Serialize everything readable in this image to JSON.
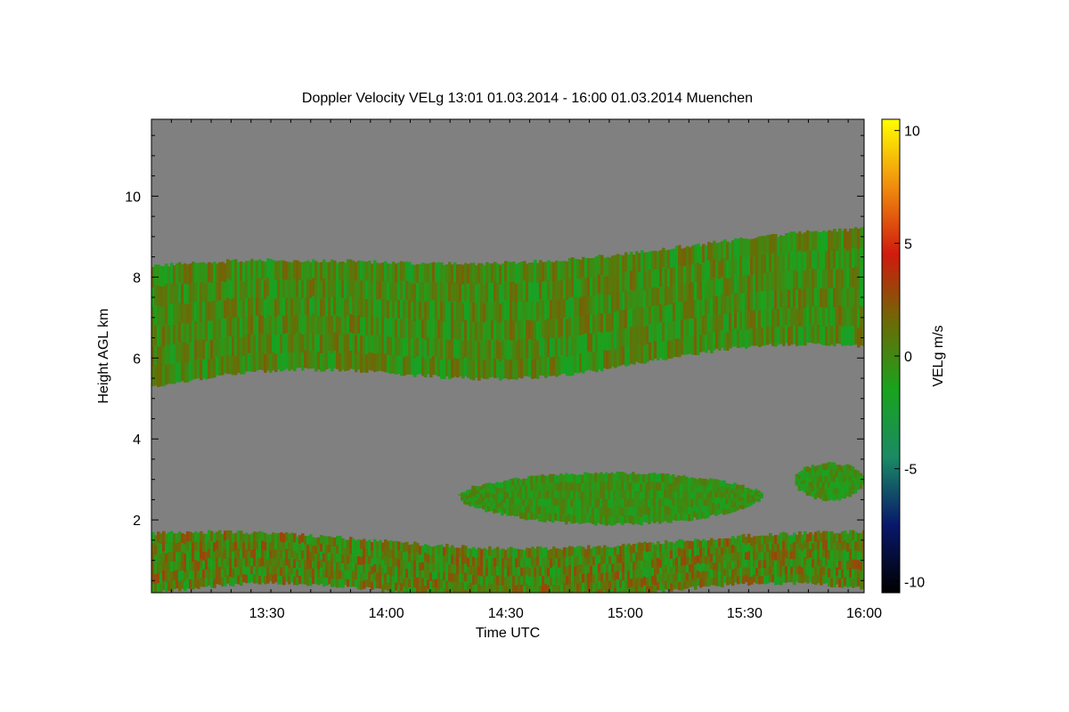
{
  "chart_data": {
    "type": "heatmap",
    "title": "Doppler Velocity VELg   13:01 01.03.2014 - 16:00 01.03.2014 Muenchen",
    "xlabel": "Time UTC",
    "ylabel": "Height AGL km",
    "xlim": [
      "13:01",
      "16:00"
    ],
    "ylim": [
      0.2,
      11.9
    ],
    "x_ticks": [
      "13:30",
      "14:00",
      "14:30",
      "15:00",
      "15:30",
      "16:00"
    ],
    "y_ticks": [
      "2",
      "4",
      "6",
      "8",
      "10"
    ],
    "colorbar": {
      "label": "VELg m/s",
      "range": [
        -10.5,
        10.5
      ],
      "ticks": [
        "-10",
        "-5",
        "0",
        "5",
        "10"
      ],
      "colors": [
        "#000000",
        "#08186b",
        "#1a8a64",
        "#19a31e",
        "#6b6b06",
        "#d01a0e",
        "#f08c0e",
        "#ffff00"
      ]
    },
    "background_color": "#808080",
    "features": [
      {
        "name": "upper cloud layer",
        "t_start": "13:01",
        "t_end": "16:00",
        "base_km": [
          5.3,
          6.2
        ],
        "top_km": [
          8.1,
          9.0
        ],
        "velocity_ms": [
          -2,
          2
        ]
      },
      {
        "name": "mid-level cloud",
        "t_start": "14:18",
        "t_end": "15:34",
        "base_km": 1.9,
        "top_km": 3.3,
        "velocity_ms": [
          -2,
          1
        ]
      },
      {
        "name": "mid-level cloud (late)",
        "t_start": "15:42",
        "t_end": "16:00",
        "base_km": 2.5,
        "top_km": 3.5,
        "velocity_ms": [
          -2,
          1
        ]
      },
      {
        "name": "boundary layer",
        "t_start": "13:01",
        "t_end": "16:00",
        "base_km": 0.2,
        "top_km": 1.5,
        "velocity_ms": [
          -2,
          3
        ]
      }
    ]
  }
}
